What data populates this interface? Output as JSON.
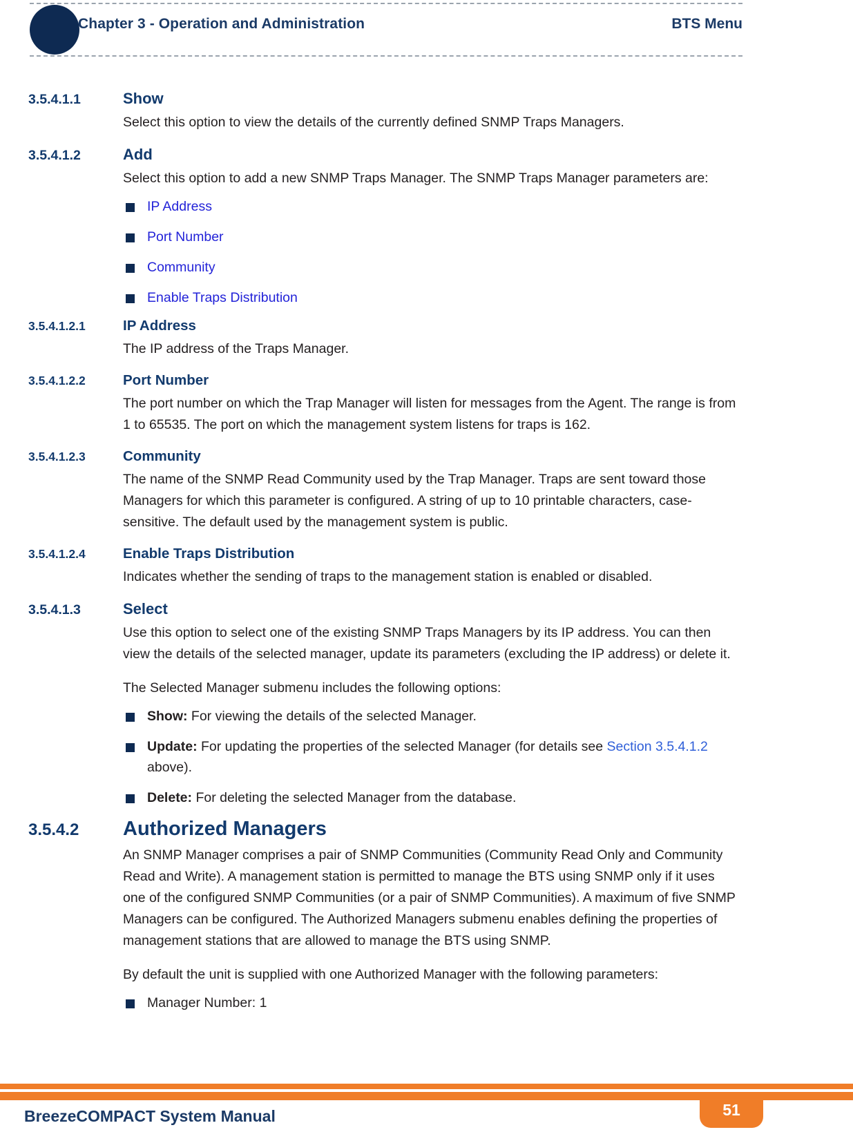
{
  "header": {
    "chapter": "Chapter 3 - Operation and Administration",
    "right_label": "BTS Menu"
  },
  "sections": {
    "show": {
      "number": "3.5.4.1.1",
      "title": "Show",
      "body": "Select this option to view the details of the currently defined SNMP Traps Managers."
    },
    "add": {
      "number": "3.5.4.1.2",
      "title": "Add",
      "body": "Select this option to add a new SNMP Traps Manager. The SNMP Traps Manager parameters are:",
      "params": [
        "IP Address",
        "Port Number",
        "Community",
        "Enable Traps Distribution"
      ]
    },
    "ip_address": {
      "number": "3.5.4.1.2.1",
      "title": "IP Address",
      "body": "The IP address of the Traps Manager."
    },
    "port_number": {
      "number": "3.5.4.1.2.2",
      "title": "Port Number",
      "body": "The port number on which the Trap Manager will listen for messages from the Agent. The range is from 1 to 65535. The port on which the management system listens for traps is 162."
    },
    "community": {
      "number": "3.5.4.1.2.3",
      "title": "Community",
      "body": "The name of the SNMP Read Community used by the Trap Manager. Traps are sent toward those Managers for which this parameter is configured. A string of up to 10 printable characters, case-sensitive. The default used by the management system is public."
    },
    "enable_traps": {
      "number": "3.5.4.1.2.4",
      "title": "Enable Traps Distribution",
      "body": "Indicates whether the sending of traps to the management station is enabled or disabled."
    },
    "select": {
      "number": "3.5.4.1.3",
      "title": "Select",
      "body": "Use this option to select one of the existing SNMP Traps Managers by its IP address. You can then view the details of the selected manager, update its parameters (excluding the IP address) or delete it.",
      "submenu_intro": "The Selected Manager submenu includes the following options:",
      "options": [
        {
          "label": "Show:",
          "text": " For viewing the details of the selected Manager.",
          "link": "",
          "after_link": ""
        },
        {
          "label": "Update:",
          "text": " For updating the properties of the selected Manager (for details see ",
          "link": "Section 3.5.4.1.2",
          "after_link": " above)."
        },
        {
          "label": "Delete:",
          "text": " For deleting the selected Manager from the database.",
          "link": "",
          "after_link": ""
        }
      ]
    },
    "authorized_managers": {
      "number": "3.5.4.2",
      "title": "Authorized Managers",
      "body": "An SNMP Manager comprises a pair of SNMP Communities (Community Read Only and Community Read and Write). A management station is permitted to manage the BTS using SNMP only if it uses one of the configured SNMP Communities (or a pair of SNMP Communities). A maximum of five SNMP Managers can be configured. The Authorized Managers submenu enables defining the properties of management stations that are allowed to manage the BTS using SNMP.",
      "default_intro": "By default the unit is supplied with one Authorized Manager with the following parameters:",
      "defaults": [
        "Manager Number: 1"
      ]
    }
  },
  "footer": {
    "title": "BreezeCOMPACT System Manual",
    "page_number": "51"
  },
  "colors": {
    "heading_navy": "#123a6d",
    "header_navy": "#1b3a66",
    "bullet_navy": "#0e2a52",
    "link_blue": "#2323d8",
    "inline_link_blue": "#2f5fd8",
    "accent_orange": "#f07d28"
  }
}
